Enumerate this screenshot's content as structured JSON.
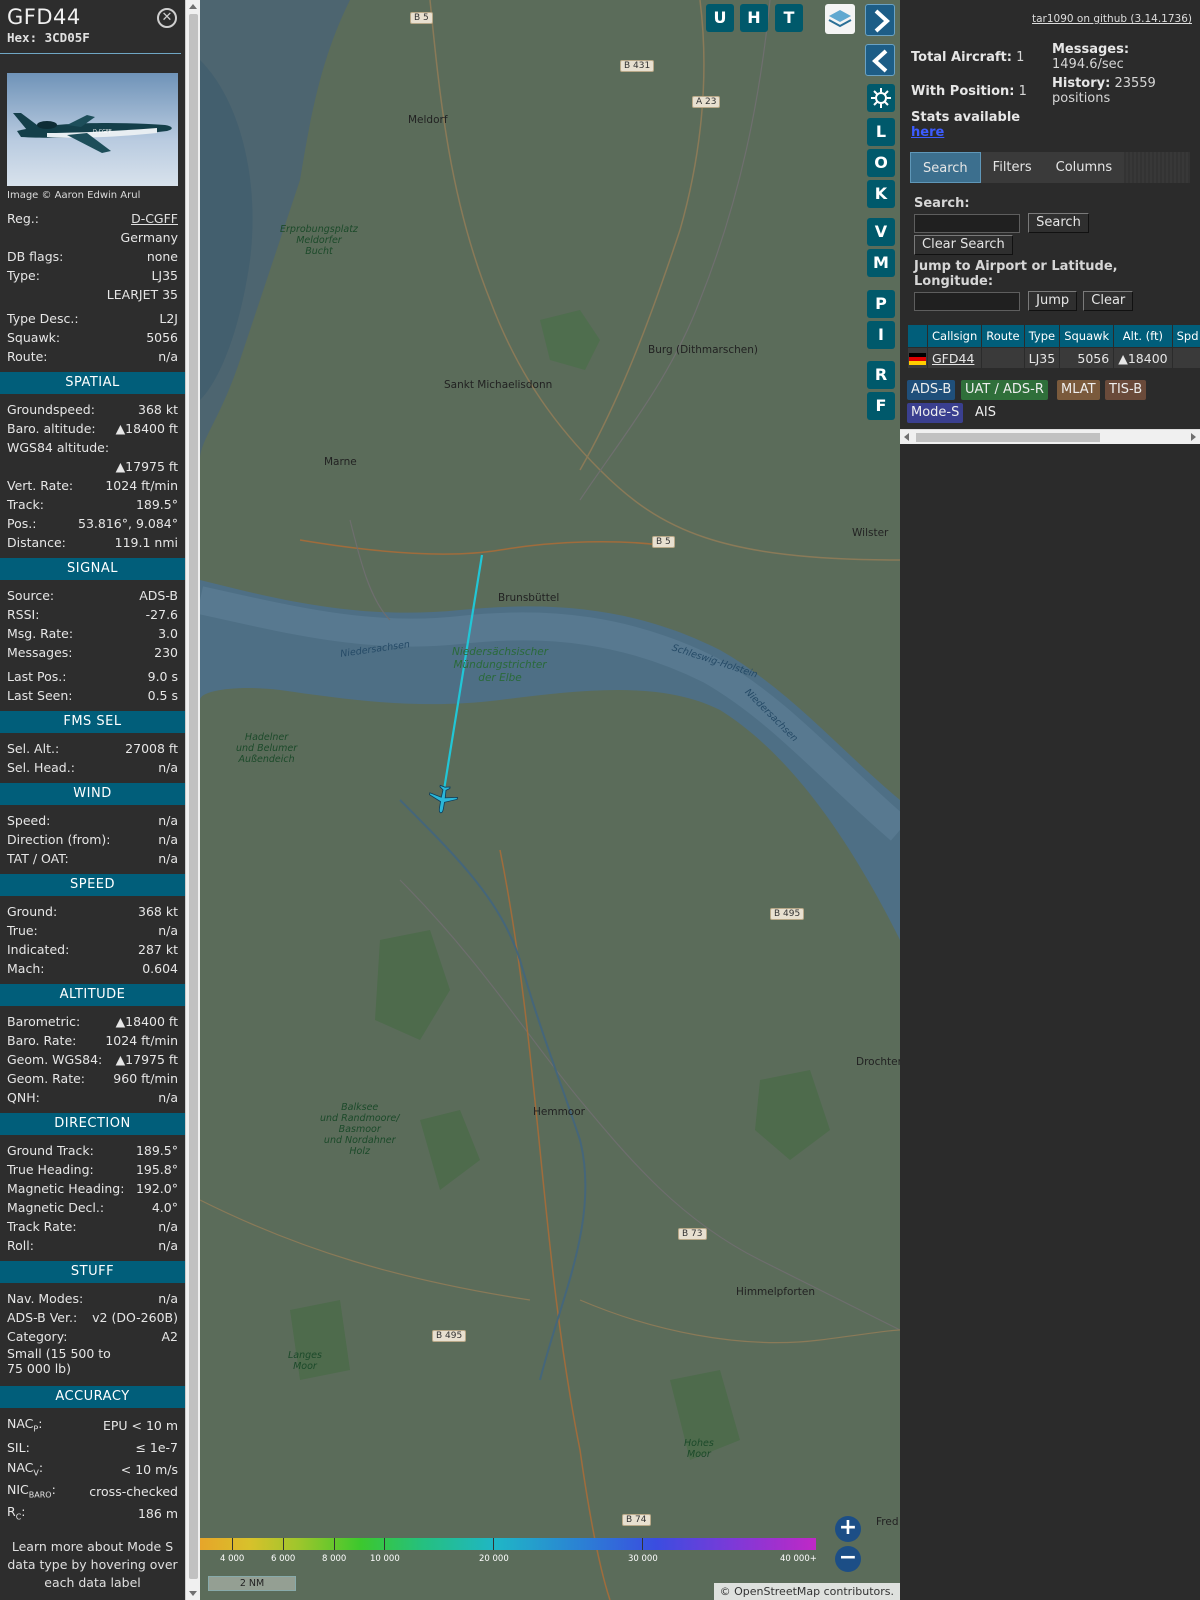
{
  "info": {
    "callsign": "GFD44",
    "hex": "Hex: 3CD05F",
    "close_icon": "close-icon",
    "photo_credit": "Image © Aaron Edwin Arul",
    "general": [
      {
        "label": "Reg.:",
        "value": "D-CGFF",
        "link": true
      },
      {
        "label": "",
        "value": "Germany"
      },
      {
        "label": "DB flags:",
        "value": "none"
      },
      {
        "label": "Type:",
        "value": "LJ35"
      },
      {
        "label": "",
        "value": "LEARJET 35"
      },
      {
        "label": "Type Desc.:",
        "value": "L2J"
      },
      {
        "label": "Squawk:",
        "value": "5056"
      },
      {
        "label": "Route:",
        "value": "n/a"
      }
    ],
    "spatial_title": "SPATIAL",
    "spatial": [
      {
        "label": "Groundspeed:",
        "value": "368 kt"
      },
      {
        "label": "Baro. altitude:",
        "value": "▲18400 ft"
      },
      {
        "label": "WGS84 altitude:",
        "value": ""
      },
      {
        "label": "",
        "value": "▲17975 ft"
      },
      {
        "label": "Vert. Rate:",
        "value": "1024 ft/min"
      },
      {
        "label": "Track:",
        "value": "189.5°"
      },
      {
        "label": "Pos.:",
        "value": "53.816°, 9.084°"
      },
      {
        "label": "Distance:",
        "value": "119.1 nmi"
      }
    ],
    "signal_title": "SIGNAL",
    "signal": [
      {
        "label": "Source:",
        "value": "ADS-B"
      },
      {
        "label": "RSSI:",
        "value": "-27.6"
      },
      {
        "label": "Msg. Rate:",
        "value": "3.0"
      },
      {
        "label": "Messages:",
        "value": "230"
      },
      {
        "label": "Last Pos.:",
        "value": "9.0 s"
      },
      {
        "label": "Last Seen:",
        "value": "0.5 s"
      }
    ],
    "fms_title": "FMS SEL",
    "fms": [
      {
        "label": "Sel. Alt.:",
        "value": "27008 ft"
      },
      {
        "label": "Sel. Head.:",
        "value": "n/a"
      }
    ],
    "wind_title": "WIND",
    "wind": [
      {
        "label": "Speed:",
        "value": "n/a"
      },
      {
        "label": "Direction (from):",
        "value": "n/a"
      },
      {
        "label": "TAT / OAT:",
        "value": "n/a"
      }
    ],
    "speed_title": "SPEED",
    "speed": [
      {
        "label": "Ground:",
        "value": "368 kt"
      },
      {
        "label": "True:",
        "value": "n/a"
      },
      {
        "label": "Indicated:",
        "value": "287 kt"
      },
      {
        "label": "Mach:",
        "value": "0.604"
      }
    ],
    "altitude_title": "ALTITUDE",
    "altitude": [
      {
        "label": "Barometric:",
        "value": "▲18400 ft"
      },
      {
        "label": "Baro. Rate:",
        "value": "1024 ft/min"
      },
      {
        "label": "Geom. WGS84:",
        "value": "▲17975 ft"
      },
      {
        "label": "Geom. Rate:",
        "value": "960 ft/min"
      },
      {
        "label": "QNH:",
        "value": "n/a"
      }
    ],
    "direction_title": "DIRECTION",
    "direction": [
      {
        "label": "Ground Track:",
        "value": "189.5°"
      },
      {
        "label": "True Heading:",
        "value": "195.8°"
      },
      {
        "label": "Magnetic Heading:",
        "value": "192.0°"
      },
      {
        "label": "Magnetic Decl.:",
        "value": "4.0°"
      },
      {
        "label": "Track Rate:",
        "value": "n/a"
      },
      {
        "label": "Roll:",
        "value": "n/a"
      }
    ],
    "stuff_title": "STUFF",
    "stuff": [
      {
        "label": "Nav. Modes:",
        "value": "n/a"
      },
      {
        "label": "ADS-B Ver.:",
        "value": "v2 (DO-260B)"
      },
      {
        "label": "Category:",
        "value": "A2"
      }
    ],
    "category_desc_1": "Small (15 500 to",
    "category_desc_2": "75 000 lb)",
    "accuracy_title": "ACCURACY",
    "accuracy": [
      {
        "label": "NAC",
        "sub": "P",
        "value": "EPU < 10 m"
      },
      {
        "label": "SIL:",
        "sub": "",
        "value": "≤ 1e-7"
      },
      {
        "label": "NAC",
        "sub": "V",
        "value": "< 10 m/s"
      },
      {
        "label": "NIC",
        "sub": "BARO",
        "value": "cross-checked"
      },
      {
        "label": "R",
        "sub": "C",
        "value": "186 m"
      }
    ],
    "footer": "Learn more about Mode S data type by hovering over each data label"
  },
  "map": {
    "places": [
      "Meldorf",
      "Burg (Dithmarschen)",
      "Sankt Michaelisdonn",
      "Marne",
      "Wilster",
      "Brunsbüttel",
      "Hemmoor",
      "Himmelpforten",
      "Drochter",
      "Fred"
    ],
    "nature": [
      "Erprobungsplatz\nMeldorfer\nBucht",
      "Niedersächsischer\nMündungstrichter\nder Elbe",
      "Hadelner\nund Belumer\nAußendeich",
      "Balksee\nund Randmoore/\nBasmoor\nund Nordahner\nHolz",
      "Langes\nMoor",
      "Hohes\nMoor"
    ],
    "water": [
      "Niedersachsen",
      "Schleswig-Holstein",
      "Niedersachsen"
    ],
    "roads": [
      "B 5",
      "B 431",
      "A 23",
      "B 5",
      "B 495",
      "B 495",
      "B 73",
      "B 74"
    ],
    "buttons": [
      "U",
      "H",
      "T",
      "L",
      "O",
      "K",
      "V",
      "M",
      "P",
      "I",
      "R",
      "F"
    ],
    "legend_ticks": [
      "4 000",
      "6 000",
      "8 000",
      "10 000",
      "20 000",
      "30 000",
      "40 000+"
    ],
    "scale": "2 NM",
    "attribution": "© OpenStreetMap contributors.",
    "zoom_in": "+",
    "zoom_out": "−"
  },
  "sidebar": {
    "version": "tar1090 on github (3.14.1736)",
    "total_aircraft_label": "Total Aircraft:",
    "total_aircraft": "1",
    "with_position_label": "With Position:",
    "with_position": "1",
    "messages_label": "Messages:",
    "messages_rate": "1494.6/sec",
    "history_label": "History:",
    "history_value": "23559",
    "history_unit": "positions",
    "stats_text": "Stats available",
    "stats_link": "here",
    "tabs": [
      "Search",
      "Filters",
      "Columns"
    ],
    "search_label": "Search:",
    "search_button": "Search",
    "clear_search_button": "Clear Search",
    "jump_label": "Jump to Airport or Latitude, Longitude:",
    "jump_button": "Jump",
    "clear_button": "Clear",
    "columns": [
      "Callsign",
      "Route",
      "Type",
      "Squawk",
      "Alt. (ft)",
      "Spd"
    ],
    "rows": [
      {
        "callsign": "GFD44",
        "route": "",
        "type": "LJ35",
        "squawk": "5056",
        "alt": "▲18400",
        "spd": ""
      }
    ],
    "sources": [
      "ADS-B",
      "UAT / ADS-R",
      "MLAT",
      "TIS-B",
      "Mode-S",
      "AIS"
    ],
    "source_colors": [
      "#1f4f7a",
      "#2f6f3a",
      "#7a5a3c",
      "#6a4a3a",
      "#3a3f8f",
      "transparent"
    ]
  }
}
